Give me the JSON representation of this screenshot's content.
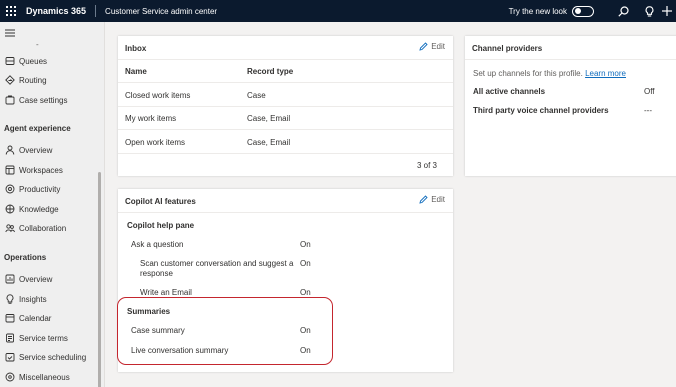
{
  "topbar": {
    "app_name": "Dynamics 365",
    "center_name": "Customer Service admin center",
    "try_new_look": "Try the new look"
  },
  "sidebar": {
    "top_items": [
      {
        "label": "Queues",
        "icon": "queues-icon"
      },
      {
        "label": "Routing",
        "icon": "routing-icon"
      },
      {
        "label": "Case settings",
        "icon": "case-settings-icon"
      }
    ],
    "agent_experience": {
      "heading": "Agent experience",
      "items": [
        {
          "label": "Overview",
          "icon": "person-icon"
        },
        {
          "label": "Workspaces",
          "icon": "workspaces-icon"
        },
        {
          "label": "Productivity",
          "icon": "productivity-icon"
        },
        {
          "label": "Knowledge",
          "icon": "knowledge-icon"
        },
        {
          "label": "Collaboration",
          "icon": "collaboration-icon"
        }
      ]
    },
    "operations": {
      "heading": "Operations",
      "items": [
        {
          "label": "Overview",
          "icon": "overview-icon"
        },
        {
          "label": "Insights",
          "icon": "insights-icon"
        },
        {
          "label": "Calendar",
          "icon": "calendar-icon"
        },
        {
          "label": "Service terms",
          "icon": "service-terms-icon"
        },
        {
          "label": "Service scheduling",
          "icon": "service-scheduling-icon"
        },
        {
          "label": "Miscellaneous",
          "icon": "miscellaneous-icon"
        }
      ]
    }
  },
  "inbox": {
    "title": "Inbox",
    "edit_label": "Edit",
    "columns": [
      "Name",
      "Record type"
    ],
    "rows": [
      {
        "name": "Closed work items",
        "record_type": "Case"
      },
      {
        "name": "My work items",
        "record_type": "Case, Email"
      },
      {
        "name": "Open work items",
        "record_type": "Case, Email"
      }
    ],
    "pagination": "3 of 3"
  },
  "channel_providers": {
    "title": "Channel providers",
    "setup_text": "Set up channels for this profile.",
    "learn_more": "Learn more",
    "rows": [
      {
        "label": "All active channels",
        "value": "Off"
      },
      {
        "label": "Third party voice channel providers",
        "value": "---"
      }
    ]
  },
  "copilot": {
    "title": "Copilot AI features",
    "edit_label": "Edit",
    "help_pane_heading": "Copilot help pane",
    "help_items": [
      {
        "label": "Ask a question",
        "value": "On"
      },
      {
        "label": "Scan customer conversation and suggest a",
        "label2": "response",
        "value": "On"
      },
      {
        "label": "Write an Email",
        "value": "On"
      }
    ],
    "summaries_heading": "Summaries",
    "summary_items": [
      {
        "label": "Case summary",
        "value": "On"
      },
      {
        "label": "Live conversation summary",
        "value": "On"
      }
    ]
  },
  "colors": {
    "topbar": "#0b1a2e",
    "link": "#0f6cbd",
    "highlight": "#c4262e"
  }
}
